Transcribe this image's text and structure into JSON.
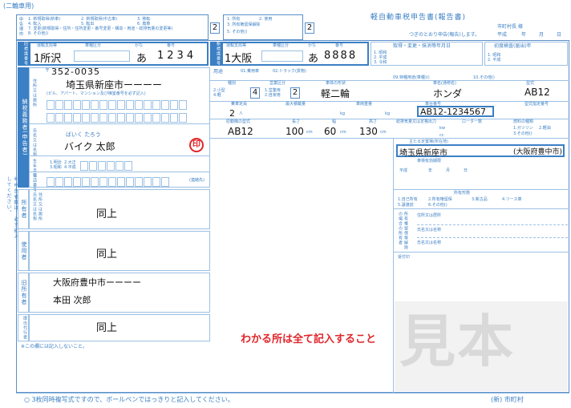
{
  "header": {
    "tag": "(二輪車用)",
    "reason_options": [
      "1. 新規取得(新車)",
      "2. 新規取得(中古車)",
      "3. 移転",
      "4. 転入",
      "5. 転出",
      "6. 廃車",
      "7. 変更(新規取得・住所・住所変更・番号変更・構造・用途・総排気量の変更等)",
      "8. その他()"
    ],
    "reason_value": "2",
    "owner_options": [
      "1. 所有",
      "2. 使用",
      "3. 所有権留保解除",
      "5. その他()"
    ],
    "owner_value": "2",
    "title": "軽自動車税申告書(報告書)",
    "addressee": "市町村長 様",
    "date_label": "つぎのとおり申告(報告)します。",
    "date_fields": [
      "平成",
      "年",
      "月",
      "日"
    ]
  },
  "plate_old": {
    "label": "旧標識番号",
    "col_labels": [
      "運輸支局等",
      "車種区分",
      "かな",
      "番号"
    ],
    "office": "1所沢",
    "kana": "あ",
    "number": "1234"
  },
  "plate_new": {
    "label": "新標識番号",
    "col_labels": [
      "運輸支局等",
      "車種区分",
      "かな",
      "番号"
    ],
    "office": "1大阪",
    "kana": "あ",
    "number": "8888"
  },
  "acquire": {
    "label": "取得・変更・抹消等年月日",
    "era_options": [
      "1. 昭和",
      "2. 平成",
      "3. 令和"
    ],
    "first_reg_label": "初度検査(届出)年",
    "first_era_options": [
      "1. 昭和",
      "2. 平成"
    ]
  },
  "usage": {
    "label": "用途",
    "options": [
      "01.乗用車",
      "02.トラック(貨物)"
    ],
    "other_options": [
      "09.特種用途(車種)()",
      "10.その他()"
    ]
  },
  "spec_row1": {
    "labels": [
      "種別",
      "営業区分",
      "車体の形状",
      "車名(通称名)",
      "型式"
    ],
    "shubetsu_options": [
      "2.小型",
      "4.軽"
    ],
    "shubetsu_value": "4",
    "eigyo_options": [
      "1.営業用",
      "2.自家用"
    ],
    "eigyo_value": "2",
    "body_shape": "軽二輪",
    "maker": "ホンダ",
    "model": "AB12"
  },
  "spec_row2": {
    "labels": [
      "乗車定員",
      "最大積載量",
      "車両重量",
      "車台番号",
      "型式指定番号"
    ],
    "capacity": "2",
    "capacity_unit": "人",
    "load_unit": "kg",
    "weight_unit": "kg",
    "chassis_no": "AB12-1234567"
  },
  "spec_row3": {
    "labels": [
      "原動機の型式",
      "長さ",
      "幅",
      "高さ",
      "総排気量又は定格出力",
      "ローター数",
      "燃料の種類"
    ],
    "engine": "AB12",
    "length": "100",
    "width": "60",
    "height": "130",
    "unit": "cm",
    "disp_unit": "kw",
    "disp_unit2": "cc",
    "fuel_options": [
      "1.ガソリン",
      "2.軽油",
      "3.その他()"
    ]
  },
  "applicant": {
    "side_label": "納税義務者(申告者)",
    "postal_label": "〒",
    "postal": "352-0035",
    "address_label": "住所又は居所",
    "address": "埼玉県新座市ーーーー",
    "building_hint": "(ビル、アパート、マンション及び棟室番号を必ず記入)",
    "furigana": "ばいく  たろう",
    "name_label": "氏名又は名称",
    "name": "バイク 太郎",
    "seal": "印",
    "birth_label": "生年月日",
    "birth_options": [
      "1.明治",
      "2.大正",
      "3.昭和",
      "4.平成"
    ],
    "phone_label": "電話番号",
    "phone_note": "(連絡先)"
  },
  "side_note": "※申告者欄は、必ず記入してください。",
  "owner_block": {
    "label": "所有者",
    "sub": "住所又は居所氏名又は名称",
    "value": "同上"
  },
  "user_block": {
    "label": "使用者",
    "value": "同上"
  },
  "former_owner": {
    "label": "旧所有者",
    "address": "大阪府豊中市ーーーー",
    "name": "本田 次郎"
  },
  "agent_block": {
    "label": "提出代行者",
    "value": "同上"
  },
  "right_panel": {
    "storage_label": "主たる定置場(所在地)",
    "storage_value": "埼玉県新座市",
    "storage_old": "(大阪府豊中市)",
    "sub_labels": [
      "車検有効期限",
      "平成",
      "年",
      "月",
      "日"
    ],
    "reason_label": "所有形態",
    "reason_options": [
      "1.自己所有",
      "2.所有権留保",
      "3.新古品",
      "4.リース車",
      "5.譲渡前",
      "6.その他()"
    ],
    "owner_info_label": "所有権留保等解除の場合の所有者",
    "fields": [
      "住所又は居所",
      "氏名又は名称",
      "氏名又は名称"
    ],
    "receipt_label": "受付印"
  },
  "notice": "わかる所は全て記入すること",
  "watermark": "見本",
  "footer_note": "※この欄には記入しないこと。",
  "footer": "○ 3枚同時複写式ですので、ボールペンではっきりと記入してください。",
  "footer_right": "(新) 市町村",
  "colors": {
    "form_blue": "#3b7fc4",
    "notice_red": "#e0262b",
    "watermark_gray": "#d9d9d9"
  }
}
